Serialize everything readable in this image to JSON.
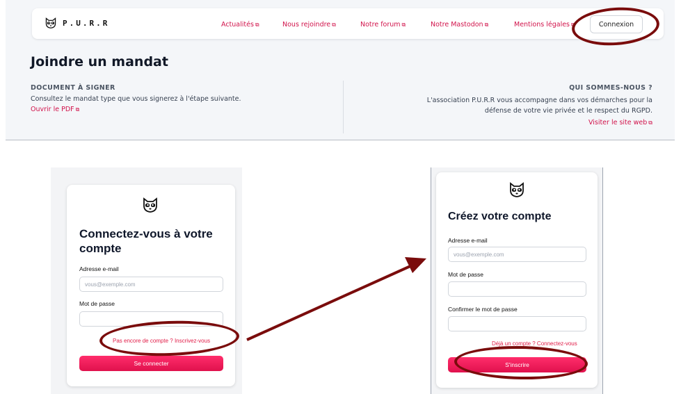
{
  "header": {
    "brand": "P.U.R.R",
    "nav": [
      {
        "label": "Actualités",
        "icon": "external-link-icon"
      },
      {
        "label": "Nous rejoindre",
        "icon": "external-link-icon"
      },
      {
        "label": "Notre forum",
        "icon": "external-link-icon"
      },
      {
        "label": "Notre Mastodon",
        "icon": "external-link-icon"
      },
      {
        "label": "Mentions légales",
        "icon": "external-link-icon"
      }
    ],
    "login_button": "Connexion"
  },
  "page": {
    "title": "Joindre un mandat",
    "document": {
      "heading": "DOCUMENT À SIGNER",
      "text": "Consultez le mandat type que vous signerez à l'étape suivante.",
      "link": "Ouvrir le PDF"
    },
    "about": {
      "heading": "QUI SOMMES-NOUS ?",
      "text": "L'association P.U.R.R vous accompagne dans vos démarches pour la défense de votre vie privée et le respect du RGPD.",
      "link": "Visiter le site web"
    }
  },
  "login": {
    "title": "Connectez-vous à votre compte",
    "email_label": "Adresse e-mail",
    "email_placeholder": "vous@exemple.com",
    "password_label": "Mot de passe",
    "register_link": "Pas encore de compte ? Inscrivez-vous",
    "submit": "Se connecter"
  },
  "signup": {
    "title": "Créez votre compte",
    "email_label": "Adresse e-mail",
    "email_placeholder": "vous@exemple.com",
    "password_label": "Mot de passe",
    "confirm_label": "Confirmer le mot de passe",
    "login_link": "Déjà un compte ? Connectez-vous",
    "submit": "S'inscrire"
  },
  "colors": {
    "accent": "#d1124a",
    "annotation": "#7a0c0c",
    "button": "#f0185a"
  },
  "icons": [
    "raccoon-logo-icon",
    "external-link-icon",
    "arrow-icon"
  ]
}
